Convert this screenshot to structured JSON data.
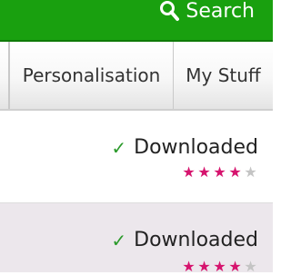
{
  "header": {
    "search_label": "Search",
    "search_icon": "magnifier-icon",
    "background_color": "#19a00f"
  },
  "tabs": [
    {
      "label": ""
    },
    {
      "label": "Personalisation"
    },
    {
      "label": "My Stuff"
    }
  ],
  "list": {
    "items": [
      {
        "status": "Downloaded",
        "status_icon": "check-icon",
        "rating": 4,
        "max_rating": 5
      },
      {
        "status": "Downloaded",
        "status_icon": "check-icon",
        "rating": 4,
        "max_rating": 5
      }
    ],
    "star_filled_color": "#d6146e",
    "star_empty_color": "#c4c4c4",
    "check_color": "#2a9a2a"
  }
}
